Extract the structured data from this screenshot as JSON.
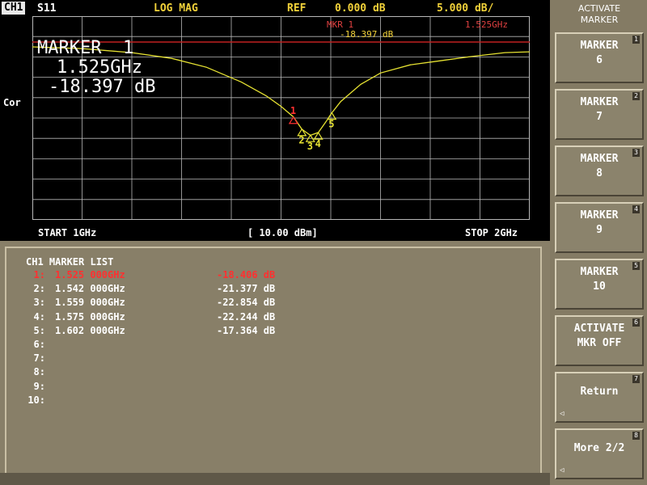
{
  "header": {
    "channel": "CH1",
    "parameter": "S11",
    "format": "LOG MAG",
    "ref_label": "REF",
    "ref_value": "0.000 dB",
    "scale": "5.000 dB/"
  },
  "side_label": "Cor",
  "marker_readout": {
    "title": "MARKER  1",
    "frequency": "1.525GHz",
    "value": "-18.397 dB",
    "small_label": "MKR 1",
    "small_freq": "1.525GHz",
    "small_value": "-18.397 dB"
  },
  "footer": {
    "start": "START 1GHz",
    "power": "[ 10.00 dBm]",
    "stop": "STOP 2GHz"
  },
  "marker_list": {
    "title": "CH1 MARKER LIST",
    "rows": [
      {
        "num": "1:",
        "freq": "1.525 000GHz",
        "value": "-18.406 dB"
      },
      {
        "num": "2:",
        "freq": "1.542 000GHz",
        "value": "-21.377 dB"
      },
      {
        "num": "3:",
        "freq": "1.559 000GHz",
        "value": "-22.854 dB"
      },
      {
        "num": "4:",
        "freq": "1.575 000GHz",
        "value": "-22.244 dB"
      },
      {
        "num": "5:",
        "freq": "1.602 000GHz",
        "value": "-17.364 dB"
      },
      {
        "num": "6:",
        "freq": "",
        "value": ""
      },
      {
        "num": "7:",
        "freq": "",
        "value": ""
      },
      {
        "num": "8:",
        "freq": "",
        "value": ""
      },
      {
        "num": "9:",
        "freq": "",
        "value": ""
      },
      {
        "num": "10:",
        "freq": "",
        "value": ""
      }
    ]
  },
  "softkeys": {
    "title": "ACTIVATE\nMARKER",
    "keys": [
      {
        "label": "MARKER\n6",
        "index": "1"
      },
      {
        "label": "MARKER\n7",
        "index": "2"
      },
      {
        "label": "MARKER\n8",
        "index": "3"
      },
      {
        "label": "MARKER\n9",
        "index": "4"
      },
      {
        "label": "MARKER\n10",
        "index": "5"
      },
      {
        "label": "ACTIVATE\nMKR OFF",
        "index": "6"
      },
      {
        "label": "Return",
        "index": "7"
      },
      {
        "label": "More 2/2",
        "index": "8"
      }
    ]
  },
  "trace": {
    "x_start_ghz": 1.0,
    "x_stop_ghz": 2.0,
    "ref_db": 0,
    "db_per_div": 5,
    "points": [
      [
        1.0,
        -1.2
      ],
      [
        1.1,
        -1.6
      ],
      [
        1.2,
        -2.6
      ],
      [
        1.28,
        -4.0
      ],
      [
        1.35,
        -6.2
      ],
      [
        1.42,
        -9.8
      ],
      [
        1.47,
        -13.2
      ],
      [
        1.5,
        -15.8
      ],
      [
        1.525,
        -18.4
      ],
      [
        1.542,
        -21.4
      ],
      [
        1.559,
        -22.9
      ],
      [
        1.575,
        -22.2
      ],
      [
        1.59,
        -19.6
      ],
      [
        1.602,
        -17.4
      ],
      [
        1.62,
        -14.6
      ],
      [
        1.66,
        -10.4
      ],
      [
        1.7,
        -7.6
      ],
      [
        1.76,
        -5.6
      ],
      [
        1.82,
        -4.6
      ],
      [
        1.88,
        -3.6
      ],
      [
        1.95,
        -2.6
      ],
      [
        2.0,
        -2.4
      ]
    ],
    "marker_labels": [
      "1",
      "2",
      "3",
      "4",
      "5"
    ],
    "colors": {
      "trace": "#e6e232",
      "grid": "#b8b8b8",
      "ref_line": "#c02020",
      "active_marker": "#ff3030"
    }
  }
}
